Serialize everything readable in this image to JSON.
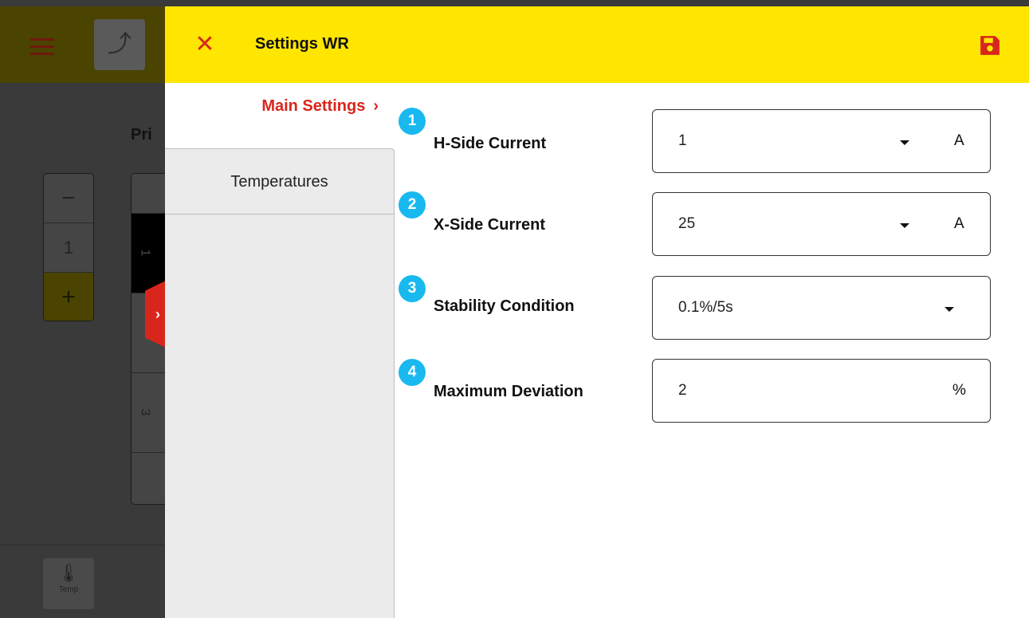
{
  "background": {
    "title": "Pri",
    "stepper": {
      "minus": "−",
      "value": "1",
      "plus": "+"
    },
    "list_items": [
      "1",
      "3"
    ],
    "temp_label": "Temp",
    "drawer_tab_glyph": "›"
  },
  "header": {
    "title": "Settings WR",
    "close_glyph": "✕",
    "accent_color": "#ffe600",
    "action_color": "#d9261c"
  },
  "nav": {
    "main_label": "Main Settings",
    "main_chevron": "›",
    "temperatures_label": "Temperatures"
  },
  "form": {
    "rows": [
      {
        "number": "1",
        "label": "H-Side Current",
        "value": "1",
        "unit": "A",
        "has_dropdown": true
      },
      {
        "number": "2",
        "label": "X-Side Current",
        "value": "25",
        "unit": "A",
        "has_dropdown": true
      },
      {
        "number": "3",
        "label": "Stability Condition",
        "value": "0.1%/5s",
        "unit": "",
        "has_dropdown": true
      },
      {
        "number": "4",
        "label": "Maximum Deviation",
        "value": "2",
        "unit": "%",
        "has_dropdown": false
      }
    ]
  },
  "icons": {
    "menu": "hamburger-icon",
    "upload": "upload-icon",
    "thermometer": "thermometer-icon",
    "save": "save-icon",
    "close": "close-icon"
  }
}
